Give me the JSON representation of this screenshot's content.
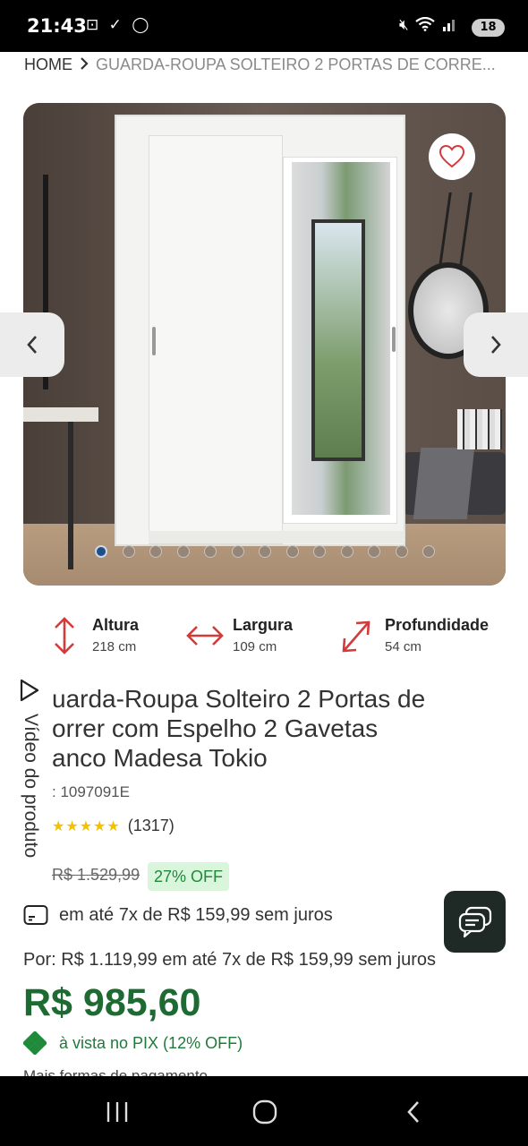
{
  "status_bar": {
    "time": "21:43",
    "left_icons": [
      "screenshot-icon",
      "download-check-icon",
      "whatsapp-icon"
    ],
    "right_icons": [
      "mute-icon",
      "wifi-icon",
      "signal-icon"
    ],
    "battery": "18"
  },
  "breadcrumb": {
    "home": "HOME",
    "separator": ">",
    "current": "GUARDA-ROUPA SOLTEIRO 2 PORTAS DE CORRE..."
  },
  "gallery": {
    "image_count": 13,
    "active_index": 0
  },
  "dimensions": [
    {
      "label": "Altura",
      "value": "218 cm",
      "icon": "height-arrows-icon"
    },
    {
      "label": "Largura",
      "value": "109 cm",
      "icon": "width-arrows-icon"
    },
    {
      "label": "Profundidade",
      "value": "54 cm",
      "icon": "depth-arrows-icon"
    }
  ],
  "video_tab": {
    "label": "Vídeo do produto"
  },
  "product": {
    "title_lines": [
      "uarda-Roupa Solteiro 2 Portas de",
      "orrer com Espelho 2 Gavetas",
      "anco Madesa Tokio"
    ],
    "sku": ": 1097091E",
    "rating_count": "(1317)",
    "rating_stars": 5
  },
  "pricing": {
    "old_price": "R$ 1.529,99",
    "discount": "27% OFF",
    "installment": "em até 7x de R$ 159,99 sem juros",
    "price_line": "Por: R$ 1.119,99 em até 7x de R$ 159,99 sem juros",
    "pix_price": "R$ 985,60",
    "pix_label": "à vista no PIX (12% OFF)",
    "more_info": "Mais formas de pagamento"
  },
  "colors": {
    "price_green": "#1d6b33",
    "heart_red": "#d23b3b",
    "badge_bg": "#d9f5dc"
  }
}
